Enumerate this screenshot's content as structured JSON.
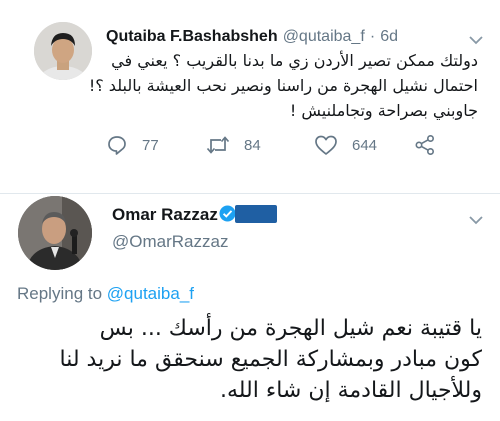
{
  "tweet_original": {
    "display_name": "Qutaiba F.Bashabsheh",
    "handle": "@qutaiba_f",
    "separator": "·",
    "time": "6d",
    "text_lines": [
      "دولتك ممكن تصير الأردن زي ما بدنا بالقريب ؟ يعني في",
      "احتمال نشيل الهجرة من راسنا ونصير نحب العيشة بالبلد ؟!",
      "جاوبني بصراحة وتجاملنيش !"
    ],
    "actions": {
      "replies": "77",
      "retweets": "84",
      "likes": "644"
    }
  },
  "tweet_reply": {
    "display_name": "Omar Razzaz",
    "handle": "@OmarRazzaz",
    "replying_prefix": "Replying to",
    "replying_to": "@qutaiba_f",
    "text_lines": [
      "يا قتيبة  نعم شيل الهجرة من رأسك ... بس",
      "كون مبادر  وبمشاركة الجميع سنحقق ما نريد لنا",
      "وللأجيال القادمة إن شاء الله."
    ]
  },
  "icons": {
    "reply": "reply-icon",
    "retweet": "retweet-icon",
    "like": "heart-icon",
    "share": "share-icon",
    "more": "chevron-down-icon",
    "verified": "verified-badge-icon"
  },
  "colors": {
    "text_primary": "#14171a",
    "text_secondary": "#657786",
    "link": "#1da1f2",
    "divider": "#e1e8ed"
  }
}
